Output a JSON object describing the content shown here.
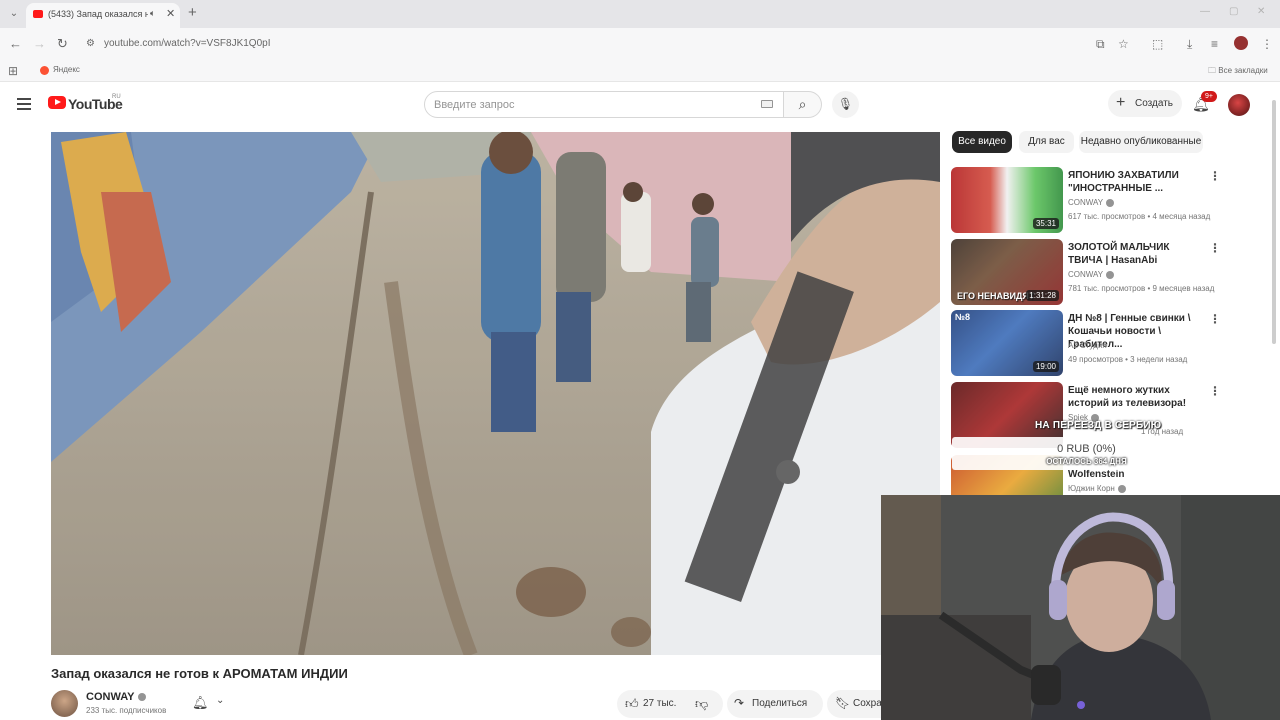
{
  "browser": {
    "tab_title": "(5433) Запад оказался не готов",
    "url": "youtube.com/watch?v=VSF8JK1Q0pI",
    "bookmarks": [
      {
        "label": "Яндекс"
      }
    ],
    "bookmarks_folder": "Все закладки"
  },
  "header": {
    "logo_text": "YouTube",
    "region": "RU",
    "search_placeholder": "Введите запрос",
    "create_label": "Создать",
    "notifications_count": "9+"
  },
  "video": {
    "title": "Запад оказался не готов к АРОМАТАМ ИНДИИ",
    "channel": "CONWAY",
    "subscribers": "233 тыс. подписчиков",
    "likes": "27 тыс.",
    "share_label": "Поделиться",
    "save_label": "Сохра"
  },
  "filters": [
    {
      "label": "Все видео",
      "active": true
    },
    {
      "label": "Для вас",
      "active": false
    },
    {
      "label": "Недавно опубликованные",
      "active": false
    }
  ],
  "recommendations": [
    {
      "title": "ЯПОНИЮ ЗАХВАТИЛИ \"ИНОСТРАННЫЕ ...",
      "channel": "CONWAY",
      "meta": "617 тыс. просмотров • 4 месяца назад",
      "duration": "35:31",
      "thumb_text": ""
    },
    {
      "title": "ЗОЛОТОЙ МАЛЬЧИК ТВИЧА | HasanAbi",
      "channel": "CONWAY",
      "meta": "781 тыс. просмотров • 9 месяцев назад",
      "duration": "1:31:28",
      "thumb_text": "ЕГО НЕНАВИДЯТ"
    },
    {
      "title": "ДН №8 | Генные свинки \\ Кошачьи новости \\ Грабител...",
      "channel": "А2 Студия",
      "meta": "49 просмотров • 3 недели назад",
      "duration": "19:00",
      "thumb_text": "№8"
    },
    {
      "title": "Ещё немного жутких историй из телевизора!",
      "channel": "Spiek",
      "meta": "1 год назад",
      "duration": "",
      "thumb_text": ""
    },
    {
      "title": "Wolfenstein",
      "channel": "Юджин Корн",
      "meta": "",
      "duration": "",
      "thumb_text": ""
    }
  ],
  "overlay": {
    "donation_goal_title": "НА ПЕРЕЕЗД В СЕРБИЮ",
    "donation_amount": "0 RUB (0%)",
    "days_left": "ОСТАЛОСЬ 364 ДНЯ"
  },
  "colors": {
    "brand": "#ff0000",
    "chip_active": "#0f0f0f",
    "chip_bg": "#f2f2f2",
    "badge": "#cc0000"
  }
}
